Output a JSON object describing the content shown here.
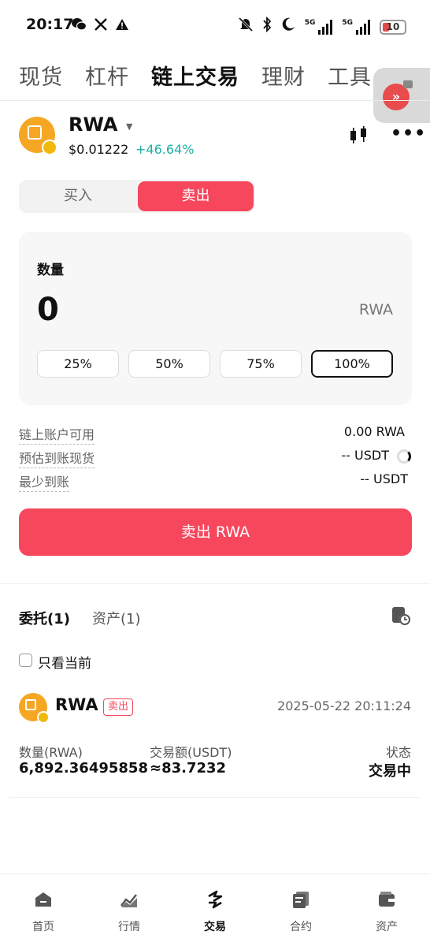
{
  "status_bar": {
    "time": "20:17",
    "battery": "10",
    "signal_labels": [
      "5G",
      "5G"
    ]
  },
  "top_tabs": [
    "现货",
    "杠杆",
    "链上交易",
    "理财",
    "工具"
  ],
  "top_tabs_active": "链上交易",
  "token": {
    "symbol": "RWA",
    "price": "$0.01222",
    "change": "+46.64%",
    "colors": {
      "change": "#1bb0a2",
      "logo": "#f5a623"
    }
  },
  "side_toggle": {
    "buy": "买入",
    "sell": "卖出",
    "selected": "卖出"
  },
  "quantity": {
    "label": "数量",
    "value": "0",
    "unit": "RWA",
    "percent_options": [
      "25%",
      "50%",
      "75%",
      "100%"
    ],
    "selected_percent": "100%"
  },
  "info": {
    "available_label": "链上账户可用",
    "available_value": "0.00 RWA",
    "estimate_label": "预估到账现货",
    "estimate_value": "-- USDT",
    "minimum_label": "最少到账",
    "minimum_value": "-- USDT"
  },
  "main_action": {
    "label": "卖出 RWA",
    "color": "#f6475d"
  },
  "orders_section": {
    "tab_orders": "委托(1)",
    "tab_assets": "资产(1)",
    "only_current_label": "只看当前",
    "only_current_checked": false
  },
  "order": {
    "symbol": "RWA",
    "side": "卖出",
    "time": "2025-05-22 20:11:24",
    "qty_label": "数量(RWA)",
    "qty_value": "6,892.36495858",
    "amount_label": "交易额(USDT)",
    "amount_value": "≈83.7232",
    "status_label": "状态",
    "status_value": "交易中"
  },
  "bottom_nav": {
    "items": [
      {
        "label": "首页",
        "icon": "home-icon"
      },
      {
        "label": "行情",
        "icon": "market-chart-icon"
      },
      {
        "label": "交易",
        "icon": "trade-swap-icon"
      },
      {
        "label": "合约",
        "icon": "futures-icon"
      },
      {
        "label": "资产",
        "icon": "wallet-icon"
      }
    ],
    "active": "交易"
  }
}
